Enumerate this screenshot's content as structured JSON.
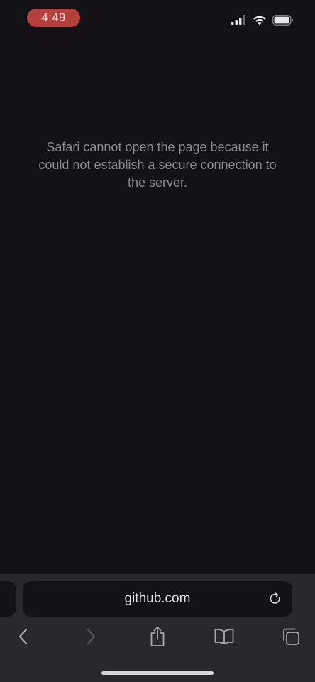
{
  "status_bar": {
    "time": "4:49",
    "icons": [
      "cellular-signal-icon",
      "wifi-icon",
      "battery-icon"
    ]
  },
  "page": {
    "error_message": "Safari cannot open the page because it could not establish a secure connection to the server."
  },
  "address_bar": {
    "url": "github.com"
  },
  "toolbar": {
    "buttons": [
      "back-icon",
      "forward-icon",
      "share-icon",
      "bookmarks-icon",
      "tabs-icon"
    ]
  },
  "colors": {
    "background": "#141117",
    "toolbar_background": "#2a282c",
    "time_pill": "#b3403c",
    "message_text": "#8b8890"
  }
}
